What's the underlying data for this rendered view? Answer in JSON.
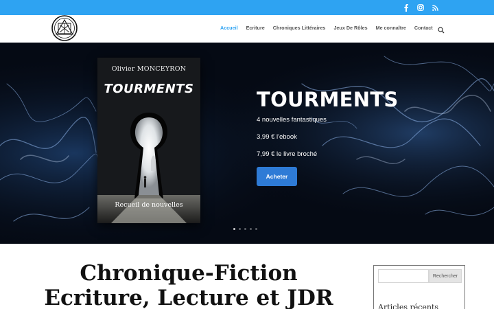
{
  "colors": {
    "topbar": "#2ea3f2",
    "accent": "#2ea3f2",
    "button": "#2e7bd6"
  },
  "social": [
    {
      "icon": "facebook-icon"
    },
    {
      "icon": "instagram-icon"
    },
    {
      "icon": "rss-icon"
    }
  ],
  "nav": {
    "items": [
      "Accueil",
      "Ecriture",
      "Chroniques Littéraires",
      "Jeux De Rôles",
      "Me connaître",
      "Contact"
    ],
    "active": "Accueil"
  },
  "slide": {
    "book_author": "Olivier MONCEYRON",
    "book_title": "TOURMENTS",
    "book_subtitle": "Recueil de nouvelles",
    "title": "TOURMENTS",
    "line1": "4 nouvelles fantastiques",
    "line2": "3,99 € l'ebook",
    "line3": "7,99 € le livre broché",
    "button": "Acheter"
  },
  "main": {
    "heading_line1": "Chronique-Fiction",
    "heading_line2": "Ecriture, Lecture et JDR"
  },
  "sidebar": {
    "search_placeholder": "",
    "search_button": "Rechercher",
    "recent_title": "Articles récents"
  }
}
